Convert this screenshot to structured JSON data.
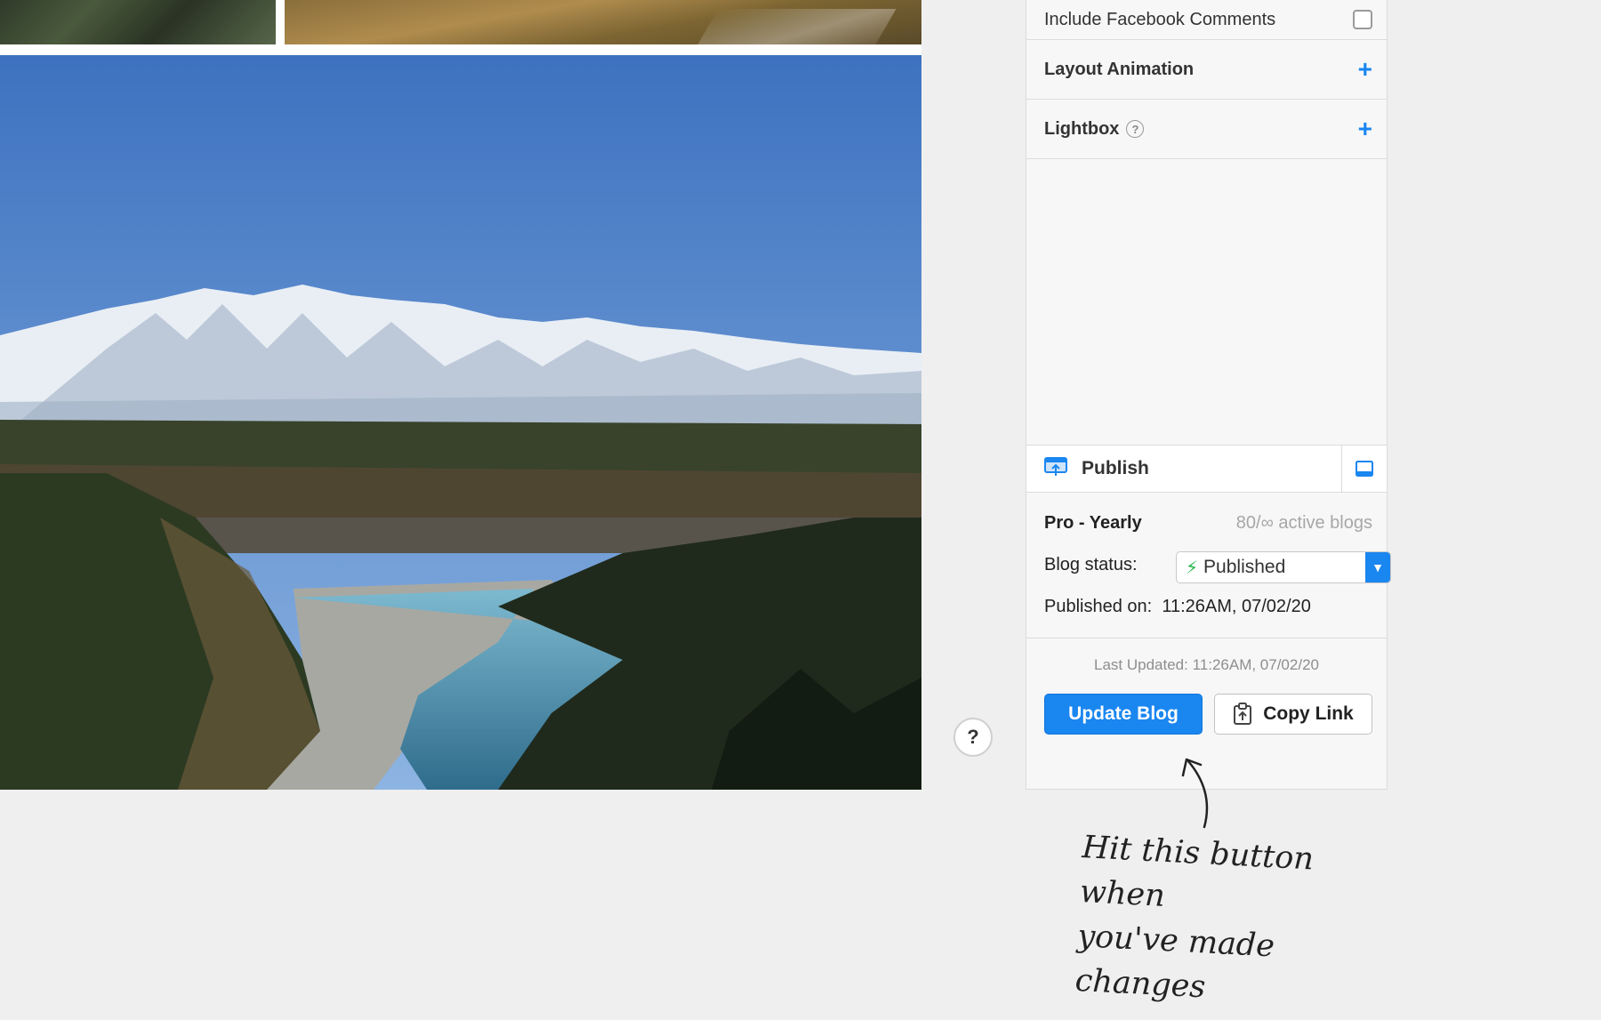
{
  "sidebar": {
    "include_facebook_comments": {
      "label": "Include Facebook Comments",
      "checked": false
    },
    "layout_animation": {
      "label": "Layout Animation",
      "icon": "plus-icon"
    },
    "lightbox": {
      "label": "Lightbox",
      "help": "?",
      "icon": "plus-icon"
    },
    "publish": {
      "label": "Publish",
      "icon": "publish-icon",
      "toggle_icon": "panel-dock-icon"
    },
    "plan": {
      "name": "Pro - Yearly",
      "usage": "80/∞ active blogs"
    },
    "blog_status": {
      "label": "Blog status:",
      "value": "Published",
      "icon": "bolt-icon"
    },
    "published_on": {
      "label": "Published on:",
      "value": "11:26AM, 07/02/20"
    },
    "last_updated": "Last Updated: 11:26AM, 07/02/20",
    "update_button": "Update Blog",
    "copy_link_button": "Copy Link"
  },
  "help_button": "?",
  "annotation": {
    "line1": "Hit this button when",
    "line2": "you've made changes"
  },
  "colors": {
    "accent": "#1a86f0",
    "status_green": "#28b64a",
    "background": "#efefef"
  }
}
